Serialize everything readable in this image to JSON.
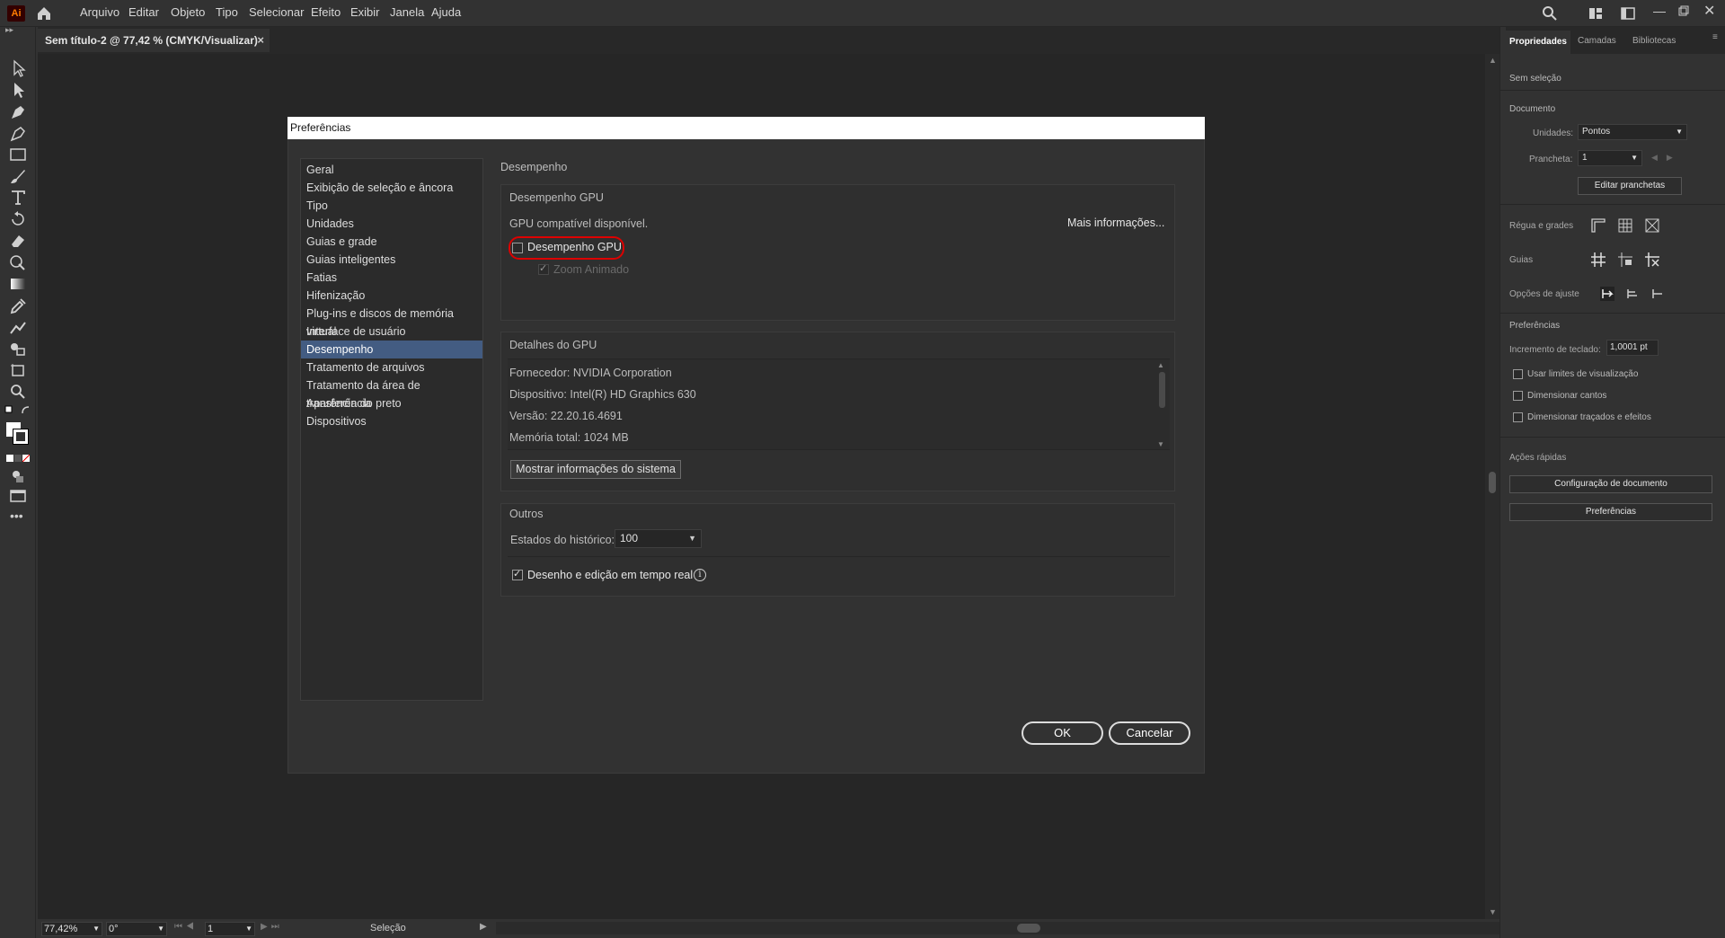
{
  "app": {
    "logo": "Ai"
  },
  "menubar": {
    "items": [
      "Arquivo",
      "Editar",
      "Objeto",
      "Tipo",
      "Selecionar",
      "Efeito",
      "Exibir",
      "Janela",
      "Ajuda"
    ]
  },
  "document_tab": {
    "title": "Sem título-2 @ 77,42 % (CMYK/Visualizar)",
    "close": "×"
  },
  "dialog": {
    "title": "Preferências",
    "nav": [
      "Geral",
      "Exibição de seleção e âncora",
      "Tipo",
      "Unidades",
      "Guias e grade",
      "Guias inteligentes",
      "Fatias",
      "Hifenização",
      "Plug-ins e discos de memória virtual",
      "Interface de usuário",
      "Desempenho",
      "Tratamento de arquivos",
      "Tratamento da área de transferência",
      "Aparência do preto",
      "Dispositivos"
    ],
    "selected_nav": "Desempenho",
    "section_title": "Desempenho",
    "gpu": {
      "group_title": "Desempenho GPU",
      "available": "GPU compatível disponível.",
      "more_info": "Mais informações...",
      "gpu_checkbox": "Desempenho GPU",
      "gpu_checked": false,
      "zoom_checkbox": "Zoom Animado",
      "zoom_checked": true
    },
    "gpu_details": {
      "group_title": "Detalhes do GPU",
      "lines": [
        "Fornecedor: NVIDIA Corporation",
        "Dispositivo: Intel(R) HD Graphics 630",
        "Versão: 22.20.16.4691",
        "Memória total: 1024 MB"
      ],
      "system_info_button": "Mostrar informações do sistema"
    },
    "others": {
      "group_title": "Outros",
      "history_label": "Estados do histórico:",
      "history_value": "100",
      "realtime_label": "Desenho e edição em tempo real",
      "realtime_checked": true
    },
    "ok": "OK",
    "cancel": "Cancelar"
  },
  "status_bar": {
    "zoom": "77,42%",
    "rotation": "0°",
    "artboard": "1",
    "tool": "Seleção"
  },
  "right_panel": {
    "tabs": [
      "Propriedades",
      "Camadas",
      "Bibliotecas"
    ],
    "no_selection": "Sem seleção",
    "document_heading": "Documento",
    "units_label": "Unidades:",
    "units_value": "Pontos",
    "artboards_label": "Prancheta:",
    "artboards_value": "1",
    "edit_artboards": "Editar pranchetas",
    "rulers_grids": "Régua e grades",
    "guides": "Guias",
    "snap_options": "Opções de ajuste",
    "preferences_heading": "Preferências",
    "keyboard_increment_label": "Incremento de teclado:",
    "keyboard_increment_value": "1,0001 pt",
    "use_preview_bounds": "Usar limites de visualização",
    "scale_corners": "Dimensionar cantos",
    "scale_strokes": "Dimensionar traçados e efeitos",
    "quick_actions": "Ações rápidas",
    "doc_setup_button": "Configuração de documento",
    "preferences_button": "Preferências"
  }
}
